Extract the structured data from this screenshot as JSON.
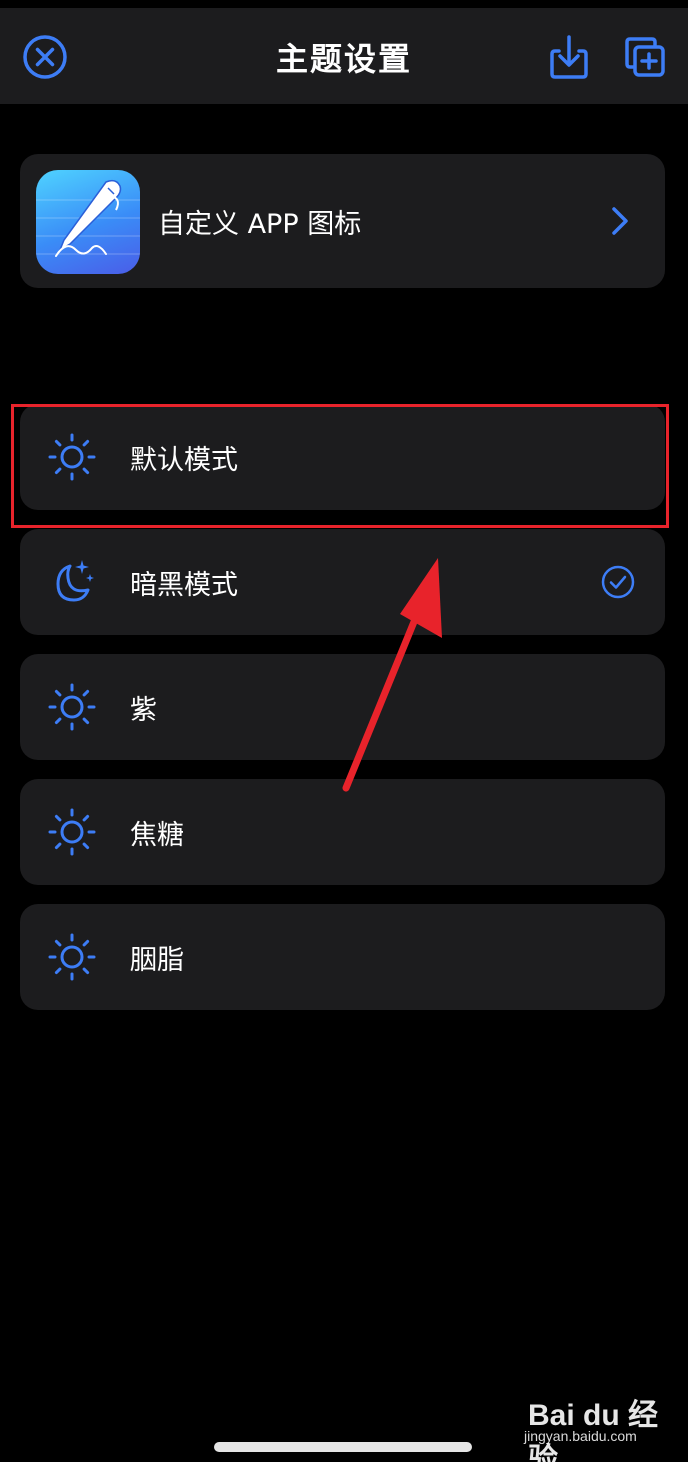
{
  "header": {
    "title": "主题设置",
    "close_icon": "close-circle-icon",
    "download_icon": "download-icon",
    "add_icon": "add-copy-icon"
  },
  "app_icon_row": {
    "label": "自定义 APP 图标",
    "icon": "pen-app-icon",
    "chevron_icon": "chevron-right-icon"
  },
  "themes": [
    {
      "label": "默认模式",
      "icon": "sun-icon",
      "selected": false,
      "highlighted": true
    },
    {
      "label": "暗黑模式",
      "icon": "moon-stars-icon",
      "selected": true,
      "highlighted": false
    },
    {
      "label": "紫",
      "icon": "sun-icon",
      "selected": false,
      "highlighted": false
    },
    {
      "label": "焦糖",
      "icon": "sun-icon",
      "selected": false,
      "highlighted": false
    },
    {
      "label": "胭脂",
      "icon": "sun-icon",
      "selected": false,
      "highlighted": false
    }
  ],
  "watermark": {
    "logo": "Bai du 经验",
    "url": "jingyan.baidu.com"
  },
  "colors": {
    "accent": "#3d7df6",
    "card": "#1c1c1e",
    "background": "#000000",
    "annotation": "#e8232b"
  }
}
